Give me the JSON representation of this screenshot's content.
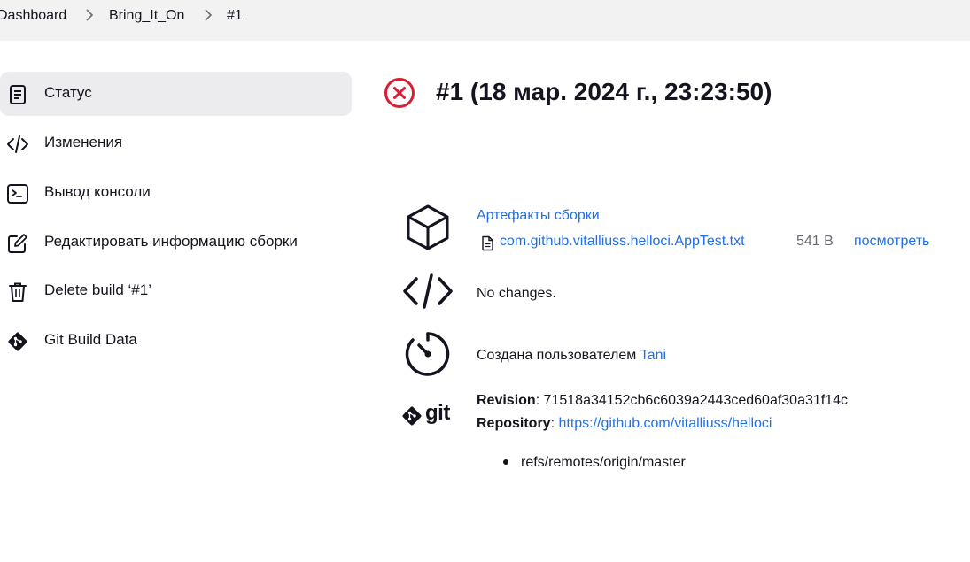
{
  "breadcrumb": {
    "items": [
      "Dashboard",
      "Bring_It_On",
      "#1"
    ]
  },
  "sidebar": {
    "items": [
      {
        "label": "Статус",
        "icon": "document-icon",
        "active": true
      },
      {
        "label": "Изменения",
        "icon": "code-icon",
        "active": false
      },
      {
        "label": "Вывод консоли",
        "icon": "terminal-icon",
        "active": false
      },
      {
        "label": "Редактировать информацию сборки",
        "icon": "edit-icon",
        "active": false
      },
      {
        "label": "Delete build ‘#1’",
        "icon": "trash-icon",
        "active": false
      },
      {
        "label": "Git Build Data",
        "icon": "git-icon",
        "active": false
      }
    ]
  },
  "build": {
    "title": "#1 (18 мар. 2024 г., 23:23:50)",
    "status": "failed",
    "status_color": "#d91f33"
  },
  "artifacts": {
    "heading": "Артефакты сборки",
    "file_name": "com.github.vitalliuss.helloci.AppTest.txt",
    "file_size": "541 B",
    "view_label": "посмотреть"
  },
  "changes": {
    "text": "No changes."
  },
  "started_by": {
    "prefix": "Создана пользователем",
    "user": "Tani"
  },
  "git": {
    "logo_text": "git",
    "revision_label": "Revision",
    "revision_value": ": 71518a34152cb6c6039a2443ced60af30a31f14c",
    "repository_label": "Repository",
    "repository_sep": ": ",
    "repository_url": "https://github.com/vitalliuss/helloci",
    "branches": [
      "refs/remotes/origin/master"
    ]
  },
  "colors": {
    "link": "#1f6feb",
    "active_bg": "#ececee",
    "topbar_bg": "#f2f2f3"
  }
}
